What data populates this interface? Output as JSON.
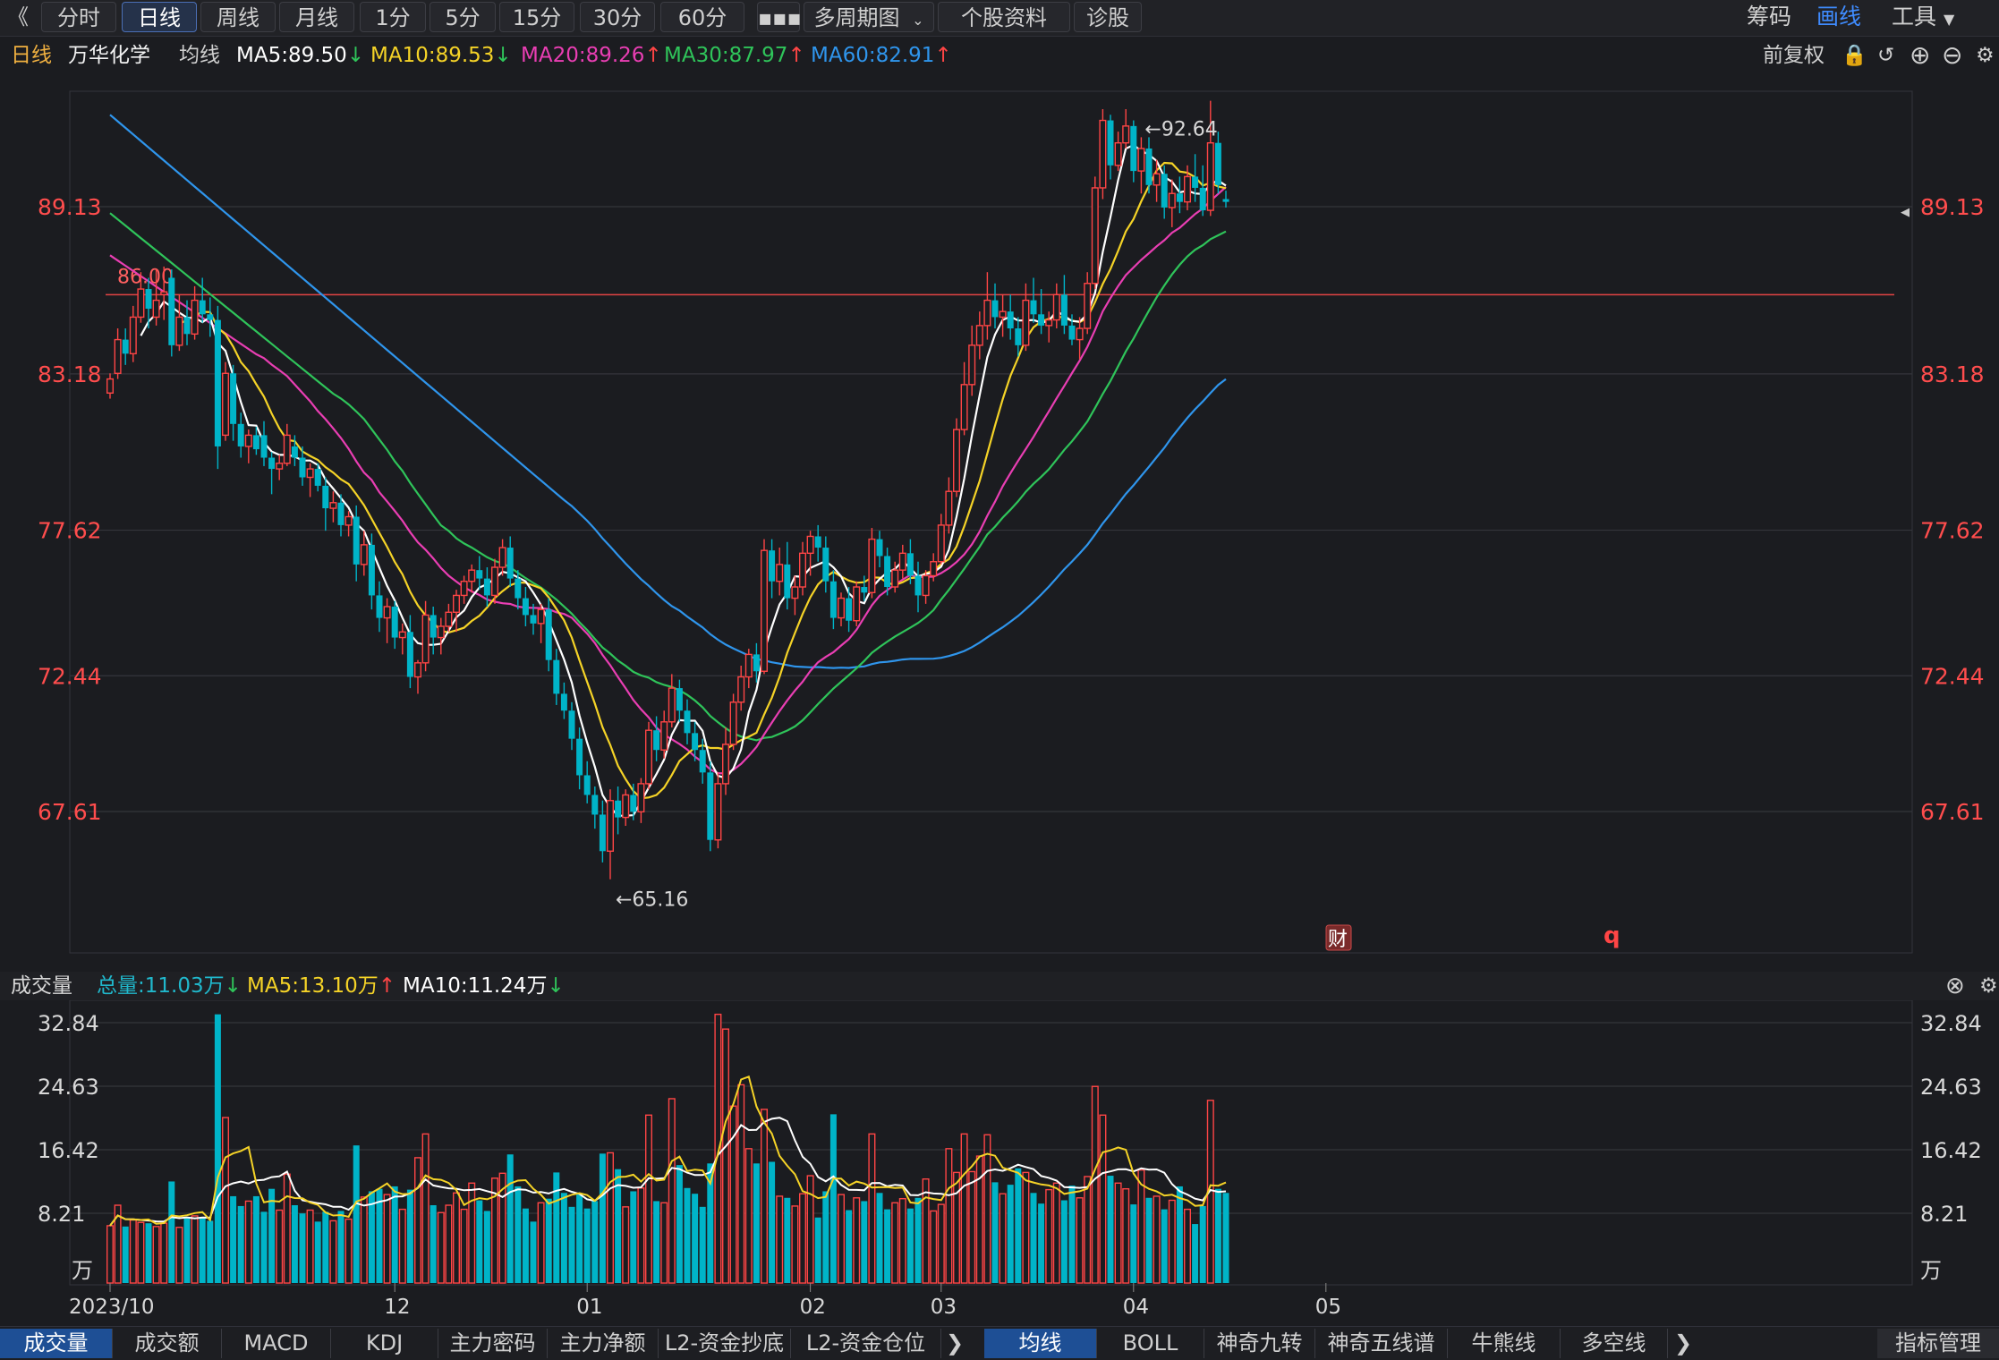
{
  "toolbar": {
    "back": "《",
    "periods": [
      "分时",
      "日线",
      "周线",
      "月线",
      "1分",
      "5分",
      "15分",
      "30分",
      "60分"
    ],
    "more": "▪▪▪",
    "multi": "多周期图",
    "info": "个股资料",
    "diag": "诊股",
    "right": [
      "筹码",
      "画线",
      "工具"
    ]
  },
  "legend": {
    "period": "日线",
    "name": "万华化学",
    "ma_label": "均线",
    "ma5": "MA5:89.50",
    "ma10": "MA10:89.53",
    "ma20": "MA20:89.26",
    "ma30": "MA30:87.97",
    "ma60": "MA60:82.91",
    "adjust": "前复权"
  },
  "volume_legend": {
    "title": "成交量",
    "total": "总量:11.03万",
    "ma5": "MA5:13.10万",
    "ma10": "MA10:11.24万"
  },
  "bottom_tabs": {
    "left": [
      "成交量",
      "成交额",
      "MACD",
      "KDJ",
      "主力密码",
      "主力净额",
      "L2-资金抄底",
      "L2-资金仓位"
    ],
    "right": [
      "均线",
      "BOLL",
      "神奇九转",
      "神奇五线谱",
      "牛熊线",
      "多空线"
    ],
    "manage": "指标管理"
  },
  "chart_data": {
    "type": "candlestick",
    "price_ticks": [
      "89.13",
      "83.18",
      "77.62",
      "72.44",
      "67.61"
    ],
    "price_ylim": [
      62.4,
      96.0
    ],
    "volume_ticks": [
      "32.84",
      "24.63",
      "16.42",
      "8.21"
    ],
    "volume_unit": "万",
    "volume_ylim": [
      0,
      33.2
    ],
    "x_labels": [
      {
        "label": "2023/10",
        "index": 0
      },
      {
        "label": "12",
        "index": 37
      },
      {
        "label": "01",
        "index": 62
      },
      {
        "label": "02",
        "index": 91
      },
      {
        "label": "03",
        "index": 108
      },
      {
        "label": "04",
        "index": 133
      },
      {
        "label": "05",
        "index": 158
      }
    ],
    "annotations": {
      "high": "←92.64",
      "low": "←65.16",
      "line_value": "86.00",
      "event_marker": "财",
      "marker2": "q"
    },
    "ref_line": 86.0,
    "colors": {
      "up": "#ff4545",
      "down": "#00b4c8",
      "ma5": "#ffffff",
      "ma10": "#f5d327",
      "ma20": "#e93eb3",
      "ma30": "#2fc45a",
      "ma60": "#2f95ec",
      "price_axis": "#ff4d4d"
    },
    "candles": [
      {
        "o": 82.5,
        "h": 83.2,
        "l": 82.3,
        "c": 83.0,
        "v": 7.0
      },
      {
        "o": 83.2,
        "h": 84.8,
        "l": 83.0,
        "c": 84.4,
        "v": 9.5
      },
      {
        "o": 84.4,
        "h": 84.8,
        "l": 83.5,
        "c": 83.9,
        "v": 6.9
      },
      {
        "o": 83.9,
        "h": 85.6,
        "l": 83.6,
        "c": 85.2,
        "v": 7.7
      },
      {
        "o": 85.2,
        "h": 86.8,
        "l": 85.0,
        "c": 86.2,
        "v": 7.4
      },
      {
        "o": 86.2,
        "h": 86.6,
        "l": 84.8,
        "c": 85.5,
        "v": 7.3
      },
      {
        "o": 85.2,
        "h": 86.9,
        "l": 84.9,
        "c": 85.8,
        "v": 6.9
      },
      {
        "o": 86.0,
        "h": 87.0,
        "l": 85.1,
        "c": 86.1,
        "v": 7.3
      },
      {
        "o": 86.6,
        "h": 86.9,
        "l": 83.8,
        "c": 84.2,
        "v": 12.4
      },
      {
        "o": 84.2,
        "h": 86.0,
        "l": 84.0,
        "c": 85.2,
        "v": 6.8
      },
      {
        "o": 85.2,
        "h": 85.8,
        "l": 84.2,
        "c": 84.6,
        "v": 8.0
      },
      {
        "o": 84.6,
        "h": 86.3,
        "l": 84.4,
        "c": 85.8,
        "v": 8.2
      },
      {
        "o": 85.8,
        "h": 86.6,
        "l": 85.0,
        "c": 85.3,
        "v": 7.9
      },
      {
        "o": 85.3,
        "h": 85.9,
        "l": 84.5,
        "c": 85.1,
        "v": 7.6
      },
      {
        "o": 85.1,
        "h": 85.6,
        "l": 79.8,
        "c": 80.6,
        "v": 32.8
      },
      {
        "o": 81.0,
        "h": 83.6,
        "l": 80.8,
        "c": 83.2,
        "v": 20.2
      },
      {
        "o": 83.2,
        "h": 83.5,
        "l": 80.8,
        "c": 81.4,
        "v": 10.6
      },
      {
        "o": 81.4,
        "h": 81.8,
        "l": 80.2,
        "c": 80.6,
        "v": 9.4
      },
      {
        "o": 80.6,
        "h": 81.2,
        "l": 80.0,
        "c": 81.0,
        "v": 10.0
      },
      {
        "o": 81.0,
        "h": 81.3,
        "l": 80.3,
        "c": 80.5,
        "v": 10.6
      },
      {
        "o": 81.0,
        "h": 81.5,
        "l": 79.9,
        "c": 80.2,
        "v": 8.7
      },
      {
        "o": 80.2,
        "h": 80.4,
        "l": 78.9,
        "c": 79.8,
        "v": 11.5
      },
      {
        "o": 79.8,
        "h": 80.3,
        "l": 79.4,
        "c": 80.0,
        "v": 8.9
      },
      {
        "o": 80.0,
        "h": 81.4,
        "l": 79.9,
        "c": 81.0,
        "v": 13.3
      },
      {
        "o": 80.6,
        "h": 81.0,
        "l": 79.9,
        "c": 80.2,
        "v": 9.5
      },
      {
        "o": 80.2,
        "h": 80.6,
        "l": 79.2,
        "c": 79.5,
        "v": 8.5
      },
      {
        "o": 79.5,
        "h": 80.0,
        "l": 78.8,
        "c": 79.8,
        "v": 8.9
      },
      {
        "o": 79.8,
        "h": 80.0,
        "l": 79.0,
        "c": 79.2,
        "v": 7.5
      },
      {
        "o": 79.2,
        "h": 79.5,
        "l": 77.6,
        "c": 78.4,
        "v": 8.7
      },
      {
        "o": 78.4,
        "h": 79.0,
        "l": 77.9,
        "c": 78.6,
        "v": 7.6
      },
      {
        "o": 78.6,
        "h": 78.9,
        "l": 77.4,
        "c": 77.8,
        "v": 8.8
      },
      {
        "o": 77.8,
        "h": 78.3,
        "l": 77.4,
        "c": 78.1,
        "v": 7.8
      },
      {
        "o": 78.1,
        "h": 78.5,
        "l": 75.8,
        "c": 76.4,
        "v": 16.8
      },
      {
        "o": 76.4,
        "h": 77.6,
        "l": 76.0,
        "c": 77.1,
        "v": 10.5
      },
      {
        "o": 77.1,
        "h": 77.5,
        "l": 74.8,
        "c": 75.3,
        "v": 11.2
      },
      {
        "o": 75.3,
        "h": 75.8,
        "l": 74.0,
        "c": 74.5,
        "v": 11.5
      },
      {
        "o": 74.5,
        "h": 75.2,
        "l": 73.6,
        "c": 74.9,
        "v": 10.8
      },
      {
        "o": 74.9,
        "h": 75.1,
        "l": 73.4,
        "c": 73.8,
        "v": 11.8
      },
      {
        "o": 73.8,
        "h": 74.3,
        "l": 73.2,
        "c": 74.0,
        "v": 9.0
      },
      {
        "o": 74.0,
        "h": 74.6,
        "l": 72.0,
        "c": 72.4,
        "v": 11.4
      },
      {
        "o": 72.4,
        "h": 73.0,
        "l": 71.8,
        "c": 72.9,
        "v": 15.3
      },
      {
        "o": 72.9,
        "h": 75.1,
        "l": 72.6,
        "c": 74.6,
        "v": 18.2
      },
      {
        "o": 74.6,
        "h": 74.9,
        "l": 73.2,
        "c": 73.8,
        "v": 9.5
      },
      {
        "o": 73.8,
        "h": 74.5,
        "l": 73.2,
        "c": 74.2,
        "v": 8.6
      },
      {
        "o": 74.2,
        "h": 75.0,
        "l": 74.0,
        "c": 74.7,
        "v": 9.5
      },
      {
        "o": 74.7,
        "h": 75.5,
        "l": 74.0,
        "c": 75.3,
        "v": 11.0
      },
      {
        "o": 75.3,
        "h": 76.0,
        "l": 75.0,
        "c": 75.8,
        "v": 9.0
      },
      {
        "o": 75.8,
        "h": 76.4,
        "l": 75.4,
        "c": 76.2,
        "v": 12.2
      },
      {
        "o": 76.2,
        "h": 76.7,
        "l": 75.5,
        "c": 75.9,
        "v": 10.1
      },
      {
        "o": 75.9,
        "h": 76.3,
        "l": 74.9,
        "c": 75.3,
        "v": 8.8
      },
      {
        "o": 75.3,
        "h": 76.6,
        "l": 75.0,
        "c": 76.3,
        "v": 12.8
      },
      {
        "o": 76.3,
        "h": 77.3,
        "l": 76.0,
        "c": 77.0,
        "v": 13.4
      },
      {
        "o": 77.0,
        "h": 77.4,
        "l": 75.6,
        "c": 75.9,
        "v": 15.7
      },
      {
        "o": 75.9,
        "h": 76.2,
        "l": 74.8,
        "c": 75.2,
        "v": 11.8
      },
      {
        "o": 75.2,
        "h": 75.6,
        "l": 74.2,
        "c": 74.6,
        "v": 9.1
      },
      {
        "o": 74.6,
        "h": 75.0,
        "l": 73.9,
        "c": 74.3,
        "v": 7.5
      },
      {
        "o": 74.3,
        "h": 75.0,
        "l": 73.6,
        "c": 74.8,
        "v": 9.8
      },
      {
        "o": 74.8,
        "h": 75.2,
        "l": 72.6,
        "c": 73.0,
        "v": 10.3
      },
      {
        "o": 73.0,
        "h": 73.4,
        "l": 71.4,
        "c": 71.8,
        "v": 13.5
      },
      {
        "o": 71.8,
        "h": 72.2,
        "l": 70.9,
        "c": 71.2,
        "v": 11.0
      },
      {
        "o": 71.2,
        "h": 71.5,
        "l": 69.8,
        "c": 70.2,
        "v": 9.3
      },
      {
        "o": 70.2,
        "h": 70.6,
        "l": 68.4,
        "c": 68.9,
        "v": 10.8
      },
      {
        "o": 68.9,
        "h": 69.4,
        "l": 67.9,
        "c": 68.2,
        "v": 9.1
      },
      {
        "o": 68.2,
        "h": 68.5,
        "l": 67.0,
        "c": 67.5,
        "v": 10.0
      },
      {
        "o": 67.5,
        "h": 68.0,
        "l": 65.8,
        "c": 66.2,
        "v": 15.8
      },
      {
        "o": 66.2,
        "h": 68.4,
        "l": 65.2,
        "c": 68.0,
        "v": 15.9
      },
      {
        "o": 68.0,
        "h": 68.5,
        "l": 66.8,
        "c": 67.4,
        "v": 13.9
      },
      {
        "o": 67.4,
        "h": 68.4,
        "l": 67.1,
        "c": 68.2,
        "v": 9.3
      },
      {
        "o": 68.2,
        "h": 68.6,
        "l": 67.3,
        "c": 67.6,
        "v": 11.2
      },
      {
        "o": 67.6,
        "h": 68.8,
        "l": 67.2,
        "c": 68.6,
        "v": 11.6
      },
      {
        "o": 68.6,
        "h": 70.8,
        "l": 68.4,
        "c": 70.5,
        "v": 20.5
      },
      {
        "o": 70.5,
        "h": 71.0,
        "l": 69.4,
        "c": 69.8,
        "v": 10.0
      },
      {
        "o": 69.8,
        "h": 71.2,
        "l": 69.5,
        "c": 70.8,
        "v": 9.8
      },
      {
        "o": 70.8,
        "h": 72.5,
        "l": 70.6,
        "c": 72.0,
        "v": 22.5
      },
      {
        "o": 72.0,
        "h": 72.3,
        "l": 70.8,
        "c": 71.2,
        "v": 14.4
      },
      {
        "o": 71.2,
        "h": 71.6,
        "l": 70.0,
        "c": 70.4,
        "v": 11.6
      },
      {
        "o": 70.4,
        "h": 70.8,
        "l": 69.4,
        "c": 69.8,
        "v": 10.9
      },
      {
        "o": 69.8,
        "h": 70.2,
        "l": 68.6,
        "c": 69.0,
        "v": 9.3
      },
      {
        "o": 69.0,
        "h": 69.4,
        "l": 66.2,
        "c": 66.6,
        "v": 14.6
      },
      {
        "o": 66.6,
        "h": 69.0,
        "l": 66.3,
        "c": 68.6,
        "v": 32.8
      },
      {
        "o": 68.6,
        "h": 70.6,
        "l": 68.2,
        "c": 70.0,
        "v": 31.0
      },
      {
        "o": 70.0,
        "h": 71.8,
        "l": 69.8,
        "c": 71.5,
        "v": 21.6
      },
      {
        "o": 71.5,
        "h": 72.8,
        "l": 71.2,
        "c": 72.4,
        "v": 24.2
      },
      {
        "o": 72.4,
        "h": 73.4,
        "l": 72.0,
        "c": 73.2,
        "v": 16.4
      },
      {
        "o": 73.2,
        "h": 73.6,
        "l": 72.2,
        "c": 72.6,
        "v": 14.6
      },
      {
        "o": 72.6,
        "h": 77.3,
        "l": 72.5,
        "c": 76.9,
        "v": 21.2
      },
      {
        "o": 76.9,
        "h": 77.3,
        "l": 75.2,
        "c": 75.8,
        "v": 14.8
      },
      {
        "o": 75.8,
        "h": 77.0,
        "l": 75.3,
        "c": 76.4,
        "v": 10.6
      },
      {
        "o": 76.4,
        "h": 77.2,
        "l": 74.8,
        "c": 75.2,
        "v": 10.4
      },
      {
        "o": 75.2,
        "h": 76.0,
        "l": 74.6,
        "c": 75.6,
        "v": 9.4
      },
      {
        "o": 75.6,
        "h": 77.2,
        "l": 75.3,
        "c": 76.8,
        "v": 10.9
      },
      {
        "o": 76.8,
        "h": 77.6,
        "l": 76.0,
        "c": 77.4,
        "v": 13.1
      },
      {
        "o": 77.4,
        "h": 77.8,
        "l": 76.5,
        "c": 77.0,
        "v": 8.0
      },
      {
        "o": 77.0,
        "h": 77.4,
        "l": 75.4,
        "c": 75.8,
        "v": 11.2
      },
      {
        "o": 75.8,
        "h": 76.2,
        "l": 74.1,
        "c": 74.5,
        "v": 20.6
      },
      {
        "o": 74.5,
        "h": 75.4,
        "l": 74.2,
        "c": 75.2,
        "v": 10.8
      },
      {
        "o": 75.2,
        "h": 75.6,
        "l": 74.0,
        "c": 74.4,
        "v": 8.9
      },
      {
        "o": 74.4,
        "h": 75.8,
        "l": 74.2,
        "c": 75.6,
        "v": 10.4
      },
      {
        "o": 75.6,
        "h": 76.0,
        "l": 75.1,
        "c": 75.4,
        "v": 10.0
      },
      {
        "o": 75.4,
        "h": 77.7,
        "l": 75.2,
        "c": 77.3,
        "v": 18.2
      },
      {
        "o": 77.3,
        "h": 77.6,
        "l": 76.3,
        "c": 76.7,
        "v": 11.0
      },
      {
        "o": 76.7,
        "h": 77.0,
        "l": 75.3,
        "c": 75.6,
        "v": 9.0
      },
      {
        "o": 75.6,
        "h": 76.5,
        "l": 75.4,
        "c": 76.2,
        "v": 9.8
      },
      {
        "o": 76.2,
        "h": 77.1,
        "l": 75.9,
        "c": 76.8,
        "v": 10.3
      },
      {
        "o": 76.8,
        "h": 77.3,
        "l": 75.7,
        "c": 76.0,
        "v": 9.1
      },
      {
        "o": 76.0,
        "h": 76.5,
        "l": 74.7,
        "c": 75.3,
        "v": 10.4
      },
      {
        "o": 75.3,
        "h": 76.2,
        "l": 75.0,
        "c": 76.0,
        "v": 12.7
      },
      {
        "o": 76.0,
        "h": 76.8,
        "l": 75.8,
        "c": 76.5,
        "v": 8.8
      },
      {
        "o": 76.5,
        "h": 78.2,
        "l": 76.4,
        "c": 77.8,
        "v": 9.6
      },
      {
        "o": 77.8,
        "h": 79.5,
        "l": 77.5,
        "c": 79.0,
        "v": 16.4
      },
      {
        "o": 79.0,
        "h": 81.6,
        "l": 78.8,
        "c": 81.2,
        "v": 13.5
      },
      {
        "o": 81.2,
        "h": 83.6,
        "l": 81.0,
        "c": 82.8,
        "v": 18.2
      },
      {
        "o": 82.8,
        "h": 84.9,
        "l": 82.4,
        "c": 84.2,
        "v": 13.6
      },
      {
        "o": 84.2,
        "h": 85.4,
        "l": 83.7,
        "c": 84.9,
        "v": 15.5
      },
      {
        "o": 84.9,
        "h": 86.8,
        "l": 84.4,
        "c": 85.8,
        "v": 18.1
      },
      {
        "o": 85.8,
        "h": 86.4,
        "l": 84.8,
        "c": 85.2,
        "v": 12.3
      },
      {
        "o": 85.2,
        "h": 86.0,
        "l": 84.5,
        "c": 85.4,
        "v": 10.9
      },
      {
        "o": 85.4,
        "h": 86.0,
        "l": 84.4,
        "c": 84.8,
        "v": 12.0
      },
      {
        "o": 84.8,
        "h": 85.2,
        "l": 83.8,
        "c": 84.2,
        "v": 14.0
      },
      {
        "o": 84.2,
        "h": 86.4,
        "l": 84.0,
        "c": 85.8,
        "v": 13.5
      },
      {
        "o": 85.8,
        "h": 86.6,
        "l": 85.0,
        "c": 85.3,
        "v": 11.0
      },
      {
        "o": 85.3,
        "h": 86.2,
        "l": 84.6,
        "c": 84.9,
        "v": 9.7
      },
      {
        "o": 84.9,
        "h": 85.4,
        "l": 84.3,
        "c": 85.1,
        "v": 11.4
      },
      {
        "o": 85.1,
        "h": 86.4,
        "l": 84.8,
        "c": 86.0,
        "v": 12.2
      },
      {
        "o": 86.0,
        "h": 86.7,
        "l": 84.6,
        "c": 84.9,
        "v": 10.1
      },
      {
        "o": 84.9,
        "h": 85.3,
        "l": 84.2,
        "c": 84.4,
        "v": 11.9
      },
      {
        "o": 84.4,
        "h": 85.2,
        "l": 83.7,
        "c": 84.8,
        "v": 10.4
      },
      {
        "o": 84.8,
        "h": 86.8,
        "l": 84.6,
        "c": 86.4,
        "v": 13.0
      },
      {
        "o": 86.4,
        "h": 90.2,
        "l": 86.2,
        "c": 89.8,
        "v": 24.0
      },
      {
        "o": 89.8,
        "h": 92.6,
        "l": 89.4,
        "c": 92.2,
        "v": 20.5
      },
      {
        "o": 92.2,
        "h": 92.4,
        "l": 90.1,
        "c": 90.6,
        "v": 13.1
      },
      {
        "o": 90.6,
        "h": 91.8,
        "l": 90.4,
        "c": 91.4,
        "v": 12.2
      },
      {
        "o": 91.4,
        "h": 92.6,
        "l": 91.2,
        "c": 92.0,
        "v": 11.5
      },
      {
        "o": 92.0,
        "h": 92.2,
        "l": 90.0,
        "c": 90.4,
        "v": 9.6
      },
      {
        "o": 90.4,
        "h": 91.6,
        "l": 89.6,
        "c": 91.2,
        "v": 13.8
      },
      {
        "o": 91.2,
        "h": 91.6,
        "l": 89.6,
        "c": 89.9,
        "v": 10.4
      },
      {
        "o": 89.9,
        "h": 90.8,
        "l": 89.3,
        "c": 90.3,
        "v": 10.6
      },
      {
        "o": 90.3,
        "h": 90.6,
        "l": 88.7,
        "c": 89.1,
        "v": 9.0
      },
      {
        "o": 89.1,
        "h": 90.1,
        "l": 88.4,
        "c": 89.6,
        "v": 10.1
      },
      {
        "o": 89.6,
        "h": 90.2,
        "l": 88.9,
        "c": 89.3,
        "v": 11.8
      },
      {
        "o": 89.3,
        "h": 90.6,
        "l": 89.0,
        "c": 90.2,
        "v": 9.0
      },
      {
        "o": 90.2,
        "h": 91.0,
        "l": 89.3,
        "c": 89.8,
        "v": 7.2
      },
      {
        "o": 89.8,
        "h": 90.6,
        "l": 88.8,
        "c": 89.0,
        "v": 9.4
      },
      {
        "o": 89.0,
        "h": 92.9,
        "l": 88.8,
        "c": 91.4,
        "v": 22.3
      },
      {
        "o": 91.4,
        "h": 91.8,
        "l": 89.6,
        "c": 89.9,
        "v": 11.5
      },
      {
        "o": 89.4,
        "h": 89.7,
        "l": 89.1,
        "c": 89.3,
        "v": 11.0
      }
    ],
    "ma_start_values": {
      "ma20": 87.4,
      "ma30": 88.9,
      "ma60": 92.4
    }
  }
}
